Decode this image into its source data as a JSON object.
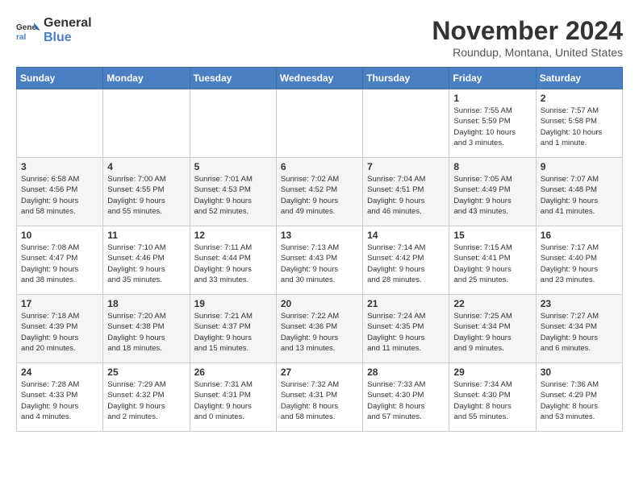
{
  "logo": {
    "text_general": "General",
    "text_blue": "Blue"
  },
  "calendar": {
    "title": "November 2024",
    "subtitle": "Roundup, Montana, United States"
  },
  "weekdays": [
    "Sunday",
    "Monday",
    "Tuesday",
    "Wednesday",
    "Thursday",
    "Friday",
    "Saturday"
  ],
  "weeks": [
    [
      {
        "day": "",
        "info": ""
      },
      {
        "day": "",
        "info": ""
      },
      {
        "day": "",
        "info": ""
      },
      {
        "day": "",
        "info": ""
      },
      {
        "day": "",
        "info": ""
      },
      {
        "day": "1",
        "info": "Sunrise: 7:55 AM\nSunset: 5:59 PM\nDaylight: 10 hours\nand 3 minutes."
      },
      {
        "day": "2",
        "info": "Sunrise: 7:57 AM\nSunset: 5:58 PM\nDaylight: 10 hours\nand 1 minute."
      }
    ],
    [
      {
        "day": "3",
        "info": "Sunrise: 6:58 AM\nSunset: 4:56 PM\nDaylight: 9 hours\nand 58 minutes."
      },
      {
        "day": "4",
        "info": "Sunrise: 7:00 AM\nSunset: 4:55 PM\nDaylight: 9 hours\nand 55 minutes."
      },
      {
        "day": "5",
        "info": "Sunrise: 7:01 AM\nSunset: 4:53 PM\nDaylight: 9 hours\nand 52 minutes."
      },
      {
        "day": "6",
        "info": "Sunrise: 7:02 AM\nSunset: 4:52 PM\nDaylight: 9 hours\nand 49 minutes."
      },
      {
        "day": "7",
        "info": "Sunrise: 7:04 AM\nSunset: 4:51 PM\nDaylight: 9 hours\nand 46 minutes."
      },
      {
        "day": "8",
        "info": "Sunrise: 7:05 AM\nSunset: 4:49 PM\nDaylight: 9 hours\nand 43 minutes."
      },
      {
        "day": "9",
        "info": "Sunrise: 7:07 AM\nSunset: 4:48 PM\nDaylight: 9 hours\nand 41 minutes."
      }
    ],
    [
      {
        "day": "10",
        "info": "Sunrise: 7:08 AM\nSunset: 4:47 PM\nDaylight: 9 hours\nand 38 minutes."
      },
      {
        "day": "11",
        "info": "Sunrise: 7:10 AM\nSunset: 4:46 PM\nDaylight: 9 hours\nand 35 minutes."
      },
      {
        "day": "12",
        "info": "Sunrise: 7:11 AM\nSunset: 4:44 PM\nDaylight: 9 hours\nand 33 minutes."
      },
      {
        "day": "13",
        "info": "Sunrise: 7:13 AM\nSunset: 4:43 PM\nDaylight: 9 hours\nand 30 minutes."
      },
      {
        "day": "14",
        "info": "Sunrise: 7:14 AM\nSunset: 4:42 PM\nDaylight: 9 hours\nand 28 minutes."
      },
      {
        "day": "15",
        "info": "Sunrise: 7:15 AM\nSunset: 4:41 PM\nDaylight: 9 hours\nand 25 minutes."
      },
      {
        "day": "16",
        "info": "Sunrise: 7:17 AM\nSunset: 4:40 PM\nDaylight: 9 hours\nand 23 minutes."
      }
    ],
    [
      {
        "day": "17",
        "info": "Sunrise: 7:18 AM\nSunset: 4:39 PM\nDaylight: 9 hours\nand 20 minutes."
      },
      {
        "day": "18",
        "info": "Sunrise: 7:20 AM\nSunset: 4:38 PM\nDaylight: 9 hours\nand 18 minutes."
      },
      {
        "day": "19",
        "info": "Sunrise: 7:21 AM\nSunset: 4:37 PM\nDaylight: 9 hours\nand 15 minutes."
      },
      {
        "day": "20",
        "info": "Sunrise: 7:22 AM\nSunset: 4:36 PM\nDaylight: 9 hours\nand 13 minutes."
      },
      {
        "day": "21",
        "info": "Sunrise: 7:24 AM\nSunset: 4:35 PM\nDaylight: 9 hours\nand 11 minutes."
      },
      {
        "day": "22",
        "info": "Sunrise: 7:25 AM\nSunset: 4:34 PM\nDaylight: 9 hours\nand 9 minutes."
      },
      {
        "day": "23",
        "info": "Sunrise: 7:27 AM\nSunset: 4:34 PM\nDaylight: 9 hours\nand 6 minutes."
      }
    ],
    [
      {
        "day": "24",
        "info": "Sunrise: 7:28 AM\nSunset: 4:33 PM\nDaylight: 9 hours\nand 4 minutes."
      },
      {
        "day": "25",
        "info": "Sunrise: 7:29 AM\nSunset: 4:32 PM\nDaylight: 9 hours\nand 2 minutes."
      },
      {
        "day": "26",
        "info": "Sunrise: 7:31 AM\nSunset: 4:31 PM\nDaylight: 9 hours\nand 0 minutes."
      },
      {
        "day": "27",
        "info": "Sunrise: 7:32 AM\nSunset: 4:31 PM\nDaylight: 8 hours\nand 58 minutes."
      },
      {
        "day": "28",
        "info": "Sunrise: 7:33 AM\nSunset: 4:30 PM\nDaylight: 8 hours\nand 57 minutes."
      },
      {
        "day": "29",
        "info": "Sunrise: 7:34 AM\nSunset: 4:30 PM\nDaylight: 8 hours\nand 55 minutes."
      },
      {
        "day": "30",
        "info": "Sunrise: 7:36 AM\nSunset: 4:29 PM\nDaylight: 8 hours\nand 53 minutes."
      }
    ]
  ]
}
